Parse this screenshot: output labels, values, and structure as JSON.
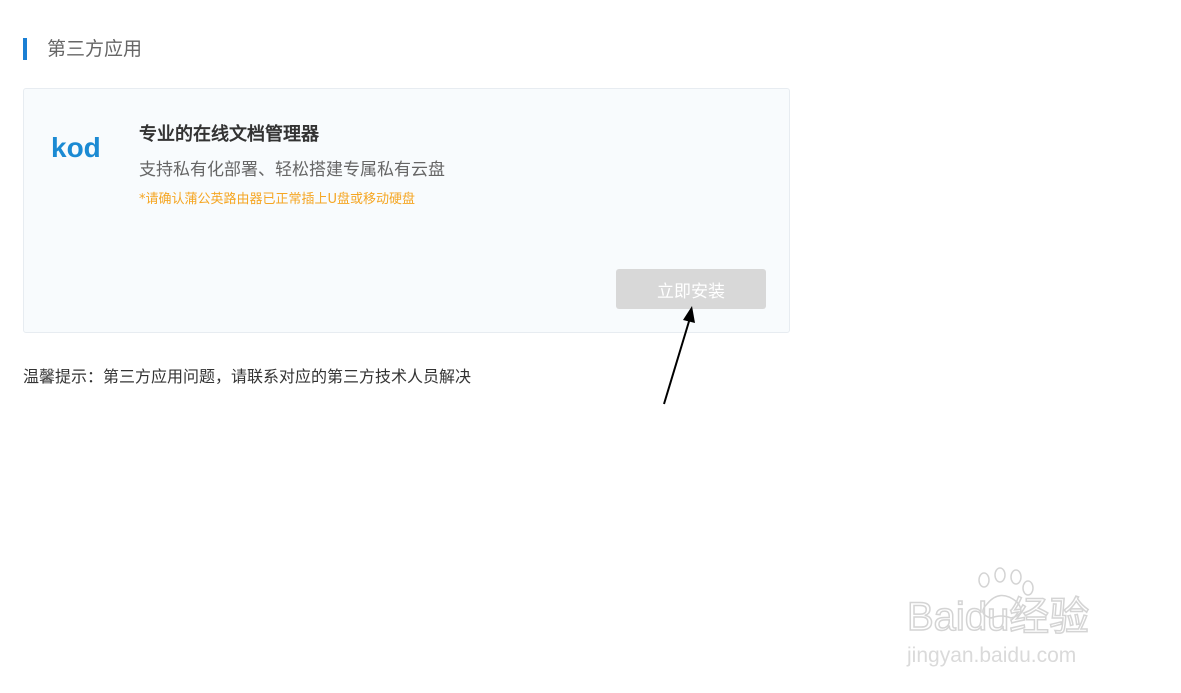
{
  "section": {
    "title": "第三方应用"
  },
  "app_card": {
    "logo_text": "kod",
    "title": "专业的在线文档管理器",
    "description": "支持私有化部署、轻松搭建专属私有云盘",
    "note": "*请确认蒲公英路由器已正常插上U盘或移动硬盘",
    "install_label": "立即安装"
  },
  "tip": {
    "text": "温馨提示：第三方应用问题，请联系对应的第三方技术人员解决"
  },
  "watermark": {
    "brand": "Baidu经验",
    "url": "jingyan.baidu.com"
  },
  "colors": {
    "accent": "#1a7fd4",
    "note": "#f5a623",
    "button_disabled": "#d8d8d8",
    "logo": "#1b8ad3"
  },
  "icons": [
    "kod-logo-icon",
    "annotation-arrow-icon",
    "baidu-paw-icon"
  ]
}
